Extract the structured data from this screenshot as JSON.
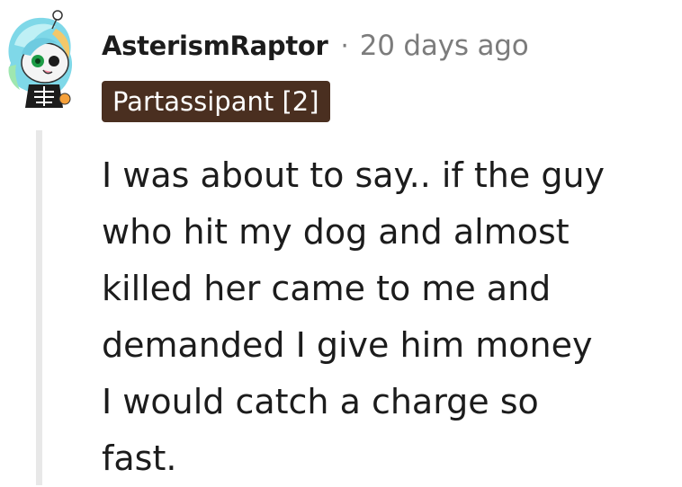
{
  "comment": {
    "author": "AsterismRaptor",
    "separator": "·",
    "timestamp": "20 days ago",
    "flair": "Partassipant [2]",
    "flair_color": "#4a2f20",
    "avatar_icon": "snoo-avatar-skeleton-icon",
    "body_lines": [
      "I was about to say.. if the guy",
      "who hit my dog and almost",
      "killed her came to me and",
      "demanded I give him money",
      "I would catch a charge so",
      "fast."
    ]
  }
}
